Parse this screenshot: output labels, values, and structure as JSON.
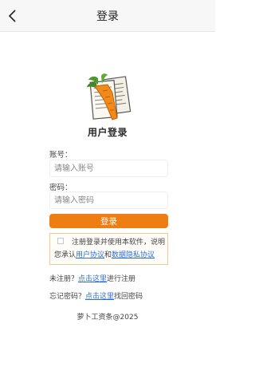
{
  "nav": {
    "title": "登录",
    "back_icon": "chevron-left-icon"
  },
  "logo": {
    "icon": "carrot-document-logo"
  },
  "subtitle": "用户登录",
  "account": {
    "label": "账号：",
    "placeholder": "请输入账号",
    "value": ""
  },
  "password": {
    "label": "密码：",
    "placeholder": "请输入密码",
    "value": ""
  },
  "login_button": "登录",
  "agreement": {
    "checked": false,
    "text_before": "注册登录并使用本软件，说明您承认",
    "user_agreement": "用户协议",
    "and": "和",
    "privacy_agreement": "数据隐私协议"
  },
  "register": {
    "prefix": "未注册？",
    "link": "点击这里",
    "suffix": "进行注册"
  },
  "recover": {
    "prefix": "忘记密码？",
    "link": "点击这里",
    "suffix": "找回密码"
  },
  "footer": "萝卜工资条@2025",
  "colors": {
    "accent": "#ef7e12",
    "link": "#2f6fd1",
    "agreement_border": "#f3c99a"
  }
}
